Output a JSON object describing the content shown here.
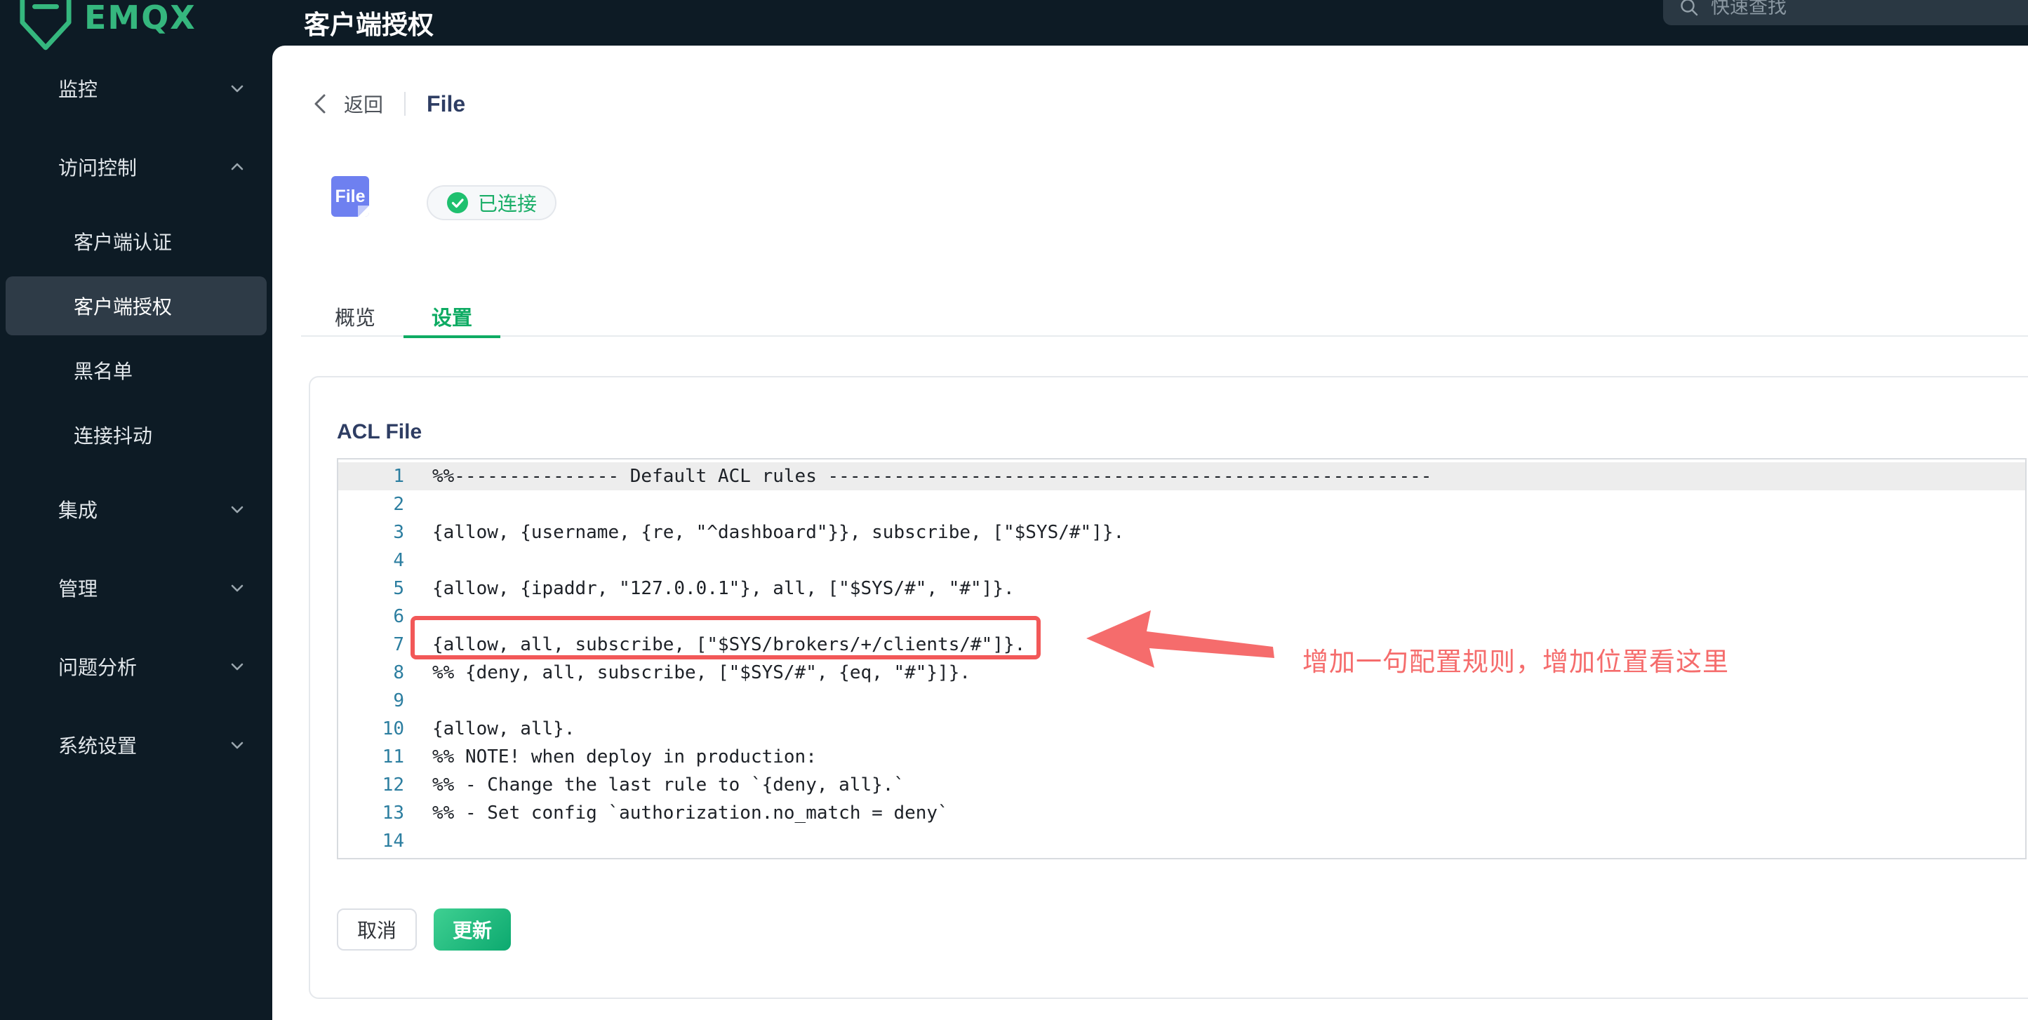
{
  "brand": {
    "logo_text": "EMQX"
  },
  "header": {
    "title": "客户端授权",
    "search_placeholder": "快速查找"
  },
  "sidebar": {
    "items": [
      {
        "label": "监控",
        "type": "group",
        "chevron": "down"
      },
      {
        "label": "访问控制",
        "type": "group",
        "chevron": "up"
      },
      {
        "label": "客户端认证",
        "type": "sub",
        "active": false
      },
      {
        "label": "客户端授权",
        "type": "sub",
        "active": true
      },
      {
        "label": "黑名单",
        "type": "sub",
        "active": false
      },
      {
        "label": "连接抖动",
        "type": "sub",
        "active": false
      },
      {
        "label": "集成",
        "type": "group",
        "chevron": "down"
      },
      {
        "label": "管理",
        "type": "group",
        "chevron": "down"
      },
      {
        "label": "问题分析",
        "type": "group",
        "chevron": "down"
      },
      {
        "label": "系统设置",
        "type": "group",
        "chevron": "down"
      }
    ]
  },
  "page": {
    "back_label": "返回",
    "title": "File",
    "badge_label": "File",
    "status_label": "已连接",
    "tabs": [
      {
        "label": "概览",
        "active": false
      },
      {
        "label": "设置",
        "active": true
      }
    ],
    "panel_title": "ACL File",
    "buttons": {
      "cancel": "取消",
      "update": "更新"
    }
  },
  "editor": {
    "lines": [
      {
        "n": 1,
        "text": "%%--------------- Default ACL rules -------------------------------------------------------",
        "highlight": true,
        "boxed": false
      },
      {
        "n": 2,
        "text": "",
        "highlight": false,
        "boxed": false
      },
      {
        "n": 3,
        "text": "{allow, {username, {re, \"^dashboard\"}}, subscribe, [\"$SYS/#\"]}.",
        "highlight": false,
        "boxed": false
      },
      {
        "n": 4,
        "text": "",
        "highlight": false,
        "boxed": false
      },
      {
        "n": 5,
        "text": "{allow, {ipaddr, \"127.0.0.1\"}, all, [\"$SYS/#\", \"#\"]}.",
        "highlight": false,
        "boxed": false
      },
      {
        "n": 6,
        "text": "",
        "highlight": false,
        "boxed": false
      },
      {
        "n": 7,
        "text": "{allow, all, subscribe, [\"$SYS/brokers/+/clients/#\"]}.",
        "highlight": false,
        "boxed": true
      },
      {
        "n": 8,
        "text": "%% {deny, all, subscribe, [\"$SYS/#\", {eq, \"#\"}]}.",
        "highlight": false,
        "boxed": false
      },
      {
        "n": 9,
        "text": "",
        "highlight": false,
        "boxed": false
      },
      {
        "n": 10,
        "text": "{allow, all}.",
        "highlight": false,
        "boxed": false
      },
      {
        "n": 11,
        "text": "%% NOTE! when deploy in production:",
        "highlight": false,
        "boxed": false
      },
      {
        "n": 12,
        "text": "%% - Change the last rule to `{deny, all}.`",
        "highlight": false,
        "boxed": false
      },
      {
        "n": 13,
        "text": "%% - Set config `authorization.no_match = deny`",
        "highlight": false,
        "boxed": false
      },
      {
        "n": 14,
        "text": "",
        "highlight": false,
        "boxed": false
      }
    ]
  },
  "annotation": {
    "text": "增加一句配置规则，增加位置看这里"
  },
  "colors": {
    "accent_green": "#0eab63",
    "brand_green": "#35b77e",
    "status_green": "#1bae68",
    "badge_blue": "#6e80f0",
    "annotation_red": "#f56c6c",
    "box_red": "#f25858",
    "sidebar_bg": "#0d1b25",
    "sidebar_active_bg": "#2e3b47",
    "line_number_blue": "#2c7ea0"
  }
}
